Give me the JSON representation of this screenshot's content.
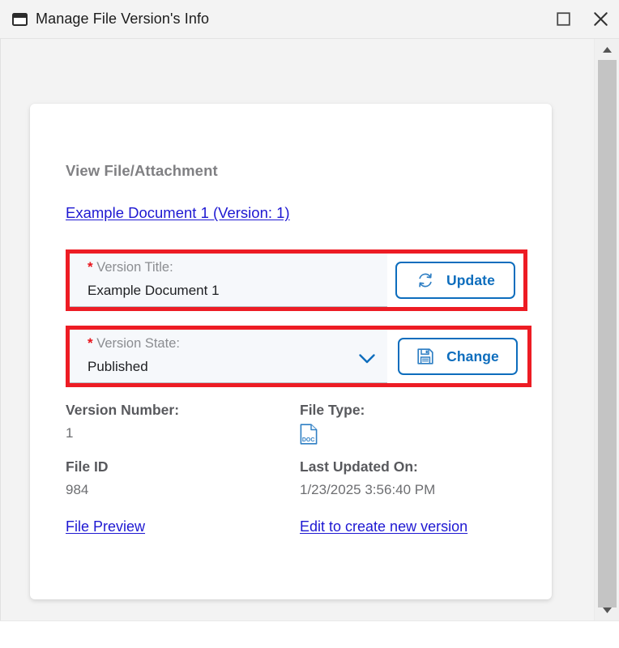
{
  "window": {
    "title": "Manage File Version's Info",
    "icon": "window-restore-icon",
    "maximize_label": "Maximize",
    "close_label": "Close"
  },
  "colors": {
    "link": "#1e18d2",
    "accent_blue": "#0d6dbd",
    "highlight_red": "#ed1c24",
    "required_red": "#e8121a",
    "label_gray": "#808083",
    "field_bg": "#f6f8fb",
    "page_bg": "#f3f3f3"
  },
  "card": {
    "section_title": "View File/Attachment",
    "document_link": "Example Document 1 (Version: 1)",
    "fields": [
      {
        "id": "version-title",
        "required_marker": "*",
        "label": "Version Title:",
        "value": "Example Document 1",
        "control": "text",
        "action_label": "Update",
        "action_icon": "refresh-icon"
      },
      {
        "id": "version-state",
        "required_marker": "*",
        "label": "Version State:",
        "value": "Published",
        "control": "select",
        "action_label": "Change",
        "action_icon": "save-icon"
      }
    ],
    "details": [
      {
        "id": "version-number",
        "label": "Version Number:",
        "value": "1"
      },
      {
        "id": "file-type",
        "label": "File Type:",
        "value": "DOC",
        "icon": "doc-file-icon"
      },
      {
        "id": "file-id",
        "label": "File ID",
        "value": "984"
      },
      {
        "id": "last-updated-on",
        "label": "Last Updated On:",
        "value": "1/23/2025 3:56:40 PM"
      }
    ],
    "links": [
      {
        "id": "file-preview",
        "label": "File Preview"
      },
      {
        "id": "edit-new-version",
        "label": "Edit to create new version"
      }
    ]
  },
  "scrollbar": {
    "up_arrow": "▲",
    "down_arrow": "▼"
  }
}
